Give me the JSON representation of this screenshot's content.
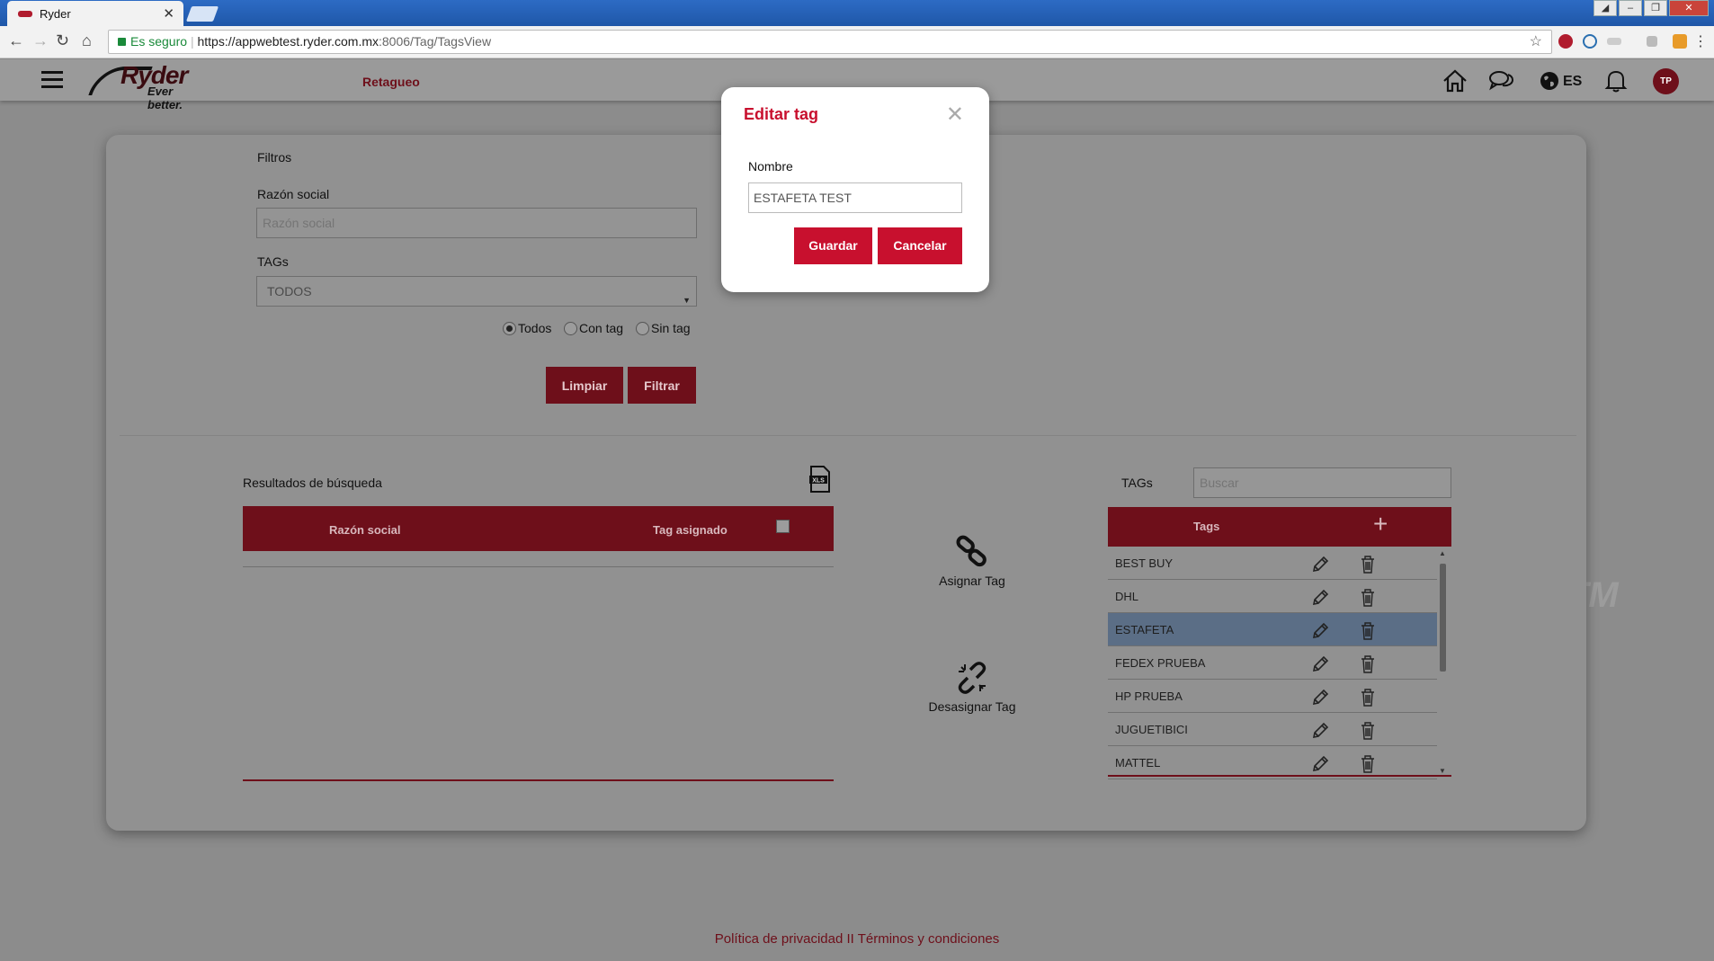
{
  "browser": {
    "tab_title": "Ryder",
    "security_label": "Es seguro",
    "url_main": "https://appwebtest.ryder.com.mx",
    "url_path": ":8006/Tag/TagsView"
  },
  "header": {
    "brand": "Ryder",
    "tagline": "Ever better.",
    "nav_link": "Retagueo",
    "language": "ES",
    "user_initials": "TP"
  },
  "filters": {
    "title": "Filtros",
    "razon_label": "Razón social",
    "razon_placeholder": "Razón social",
    "tags_label": "TAGs",
    "tags_selected": "TODOS",
    "radio_options": [
      "Todos",
      "Con tag",
      "Sin tag"
    ],
    "radio_selected": "Todos",
    "clear_label": "Limpiar",
    "filter_label": "Filtrar"
  },
  "results": {
    "title": "Resultados de búsqueda",
    "export_icon": "xls-file-icon",
    "columns": [
      "Razón social",
      "Tag asignado"
    ],
    "rows": []
  },
  "actions": {
    "assign_label": "Asignar Tag",
    "unassign_label": "Desasignar Tag"
  },
  "tags_panel": {
    "label": "TAGs",
    "search_placeholder": "Buscar",
    "column": "Tags",
    "add_icon": "plus-icon",
    "items": [
      "BEST BUY",
      "DHL",
      "ESTAFETA",
      "FEDEX PRUEBA",
      "HP PRUEBA",
      "JUGUETIBICI",
      "MATTEL"
    ],
    "selected": "ESTAFETA"
  },
  "footer": {
    "text": "Política de privacidad II Términos y condiciones"
  },
  "modal": {
    "title": "Editar tag",
    "field_label": "Nombre",
    "field_value": "ESTAFETA TEST",
    "save_label": "Guardar",
    "cancel_label": "Cancelar"
  },
  "background": {
    "trademark": "TM"
  },
  "colors": {
    "brand_red": "#c8102e",
    "dimmed_red": "#6e0f1a",
    "selected_row": "#5b6e86"
  }
}
